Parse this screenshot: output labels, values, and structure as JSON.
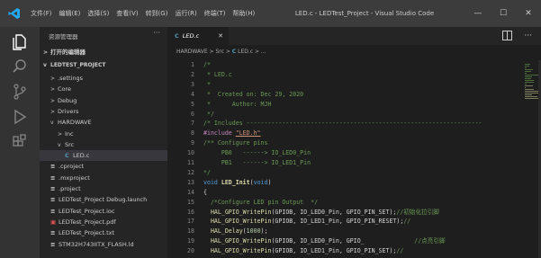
{
  "titlebar": {
    "menu": [
      "文件(F)",
      "编辑(E)",
      "选择(S)",
      "查看(V)",
      "转到(G)",
      "运行(R)",
      "终端(T)",
      "帮助(H)"
    ],
    "title": "LED.c - LEDTest_Project - Visual Studio Code",
    "controls": {
      "minimize": "—",
      "maximize": "☐",
      "close": "✕"
    }
  },
  "activity_bar": {
    "icons": [
      "explorer-icon",
      "search-icon",
      "source-control-icon",
      "run-debug-icon",
      "extensions-icon"
    ]
  },
  "sidebar": {
    "header": "资源管理器",
    "more": "···",
    "open_editors_label": "打开的编辑器",
    "project_label": "LEDTEST_PROJECT",
    "items": [
      {
        "label": ".settings",
        "kind": "folder",
        "expanded": false,
        "depth": 1
      },
      {
        "label": "Core",
        "kind": "folder",
        "expanded": false,
        "depth": 1
      },
      {
        "label": "Debug",
        "kind": "folder",
        "expanded": false,
        "depth": 1
      },
      {
        "label": "Drivers",
        "kind": "folder",
        "expanded": false,
        "depth": 1
      },
      {
        "label": "HARDWAVE",
        "kind": "folder",
        "expanded": true,
        "depth": 1
      },
      {
        "label": "Inc",
        "kind": "folder",
        "expanded": false,
        "depth": 2
      },
      {
        "label": "Src",
        "kind": "folder",
        "expanded": true,
        "depth": 2
      },
      {
        "label": "LED.c",
        "kind": "c",
        "depth": 3,
        "selected": true
      },
      {
        "label": ".cproject",
        "kind": "file",
        "depth": 1
      },
      {
        "label": ".mxproject",
        "kind": "file",
        "depth": 1
      },
      {
        "label": ".project",
        "kind": "file",
        "depth": 1
      },
      {
        "label": "LEDTest_Project Debug.launch",
        "kind": "file",
        "depth": 1
      },
      {
        "label": "LEDTest_Project.ioc",
        "kind": "ioc",
        "depth": 1
      },
      {
        "label": "LEDTest_Project.pdf",
        "kind": "pdf",
        "depth": 1
      },
      {
        "label": "LEDTest_Project.txt",
        "kind": "file",
        "depth": 1
      },
      {
        "label": "STM32H743IITX_FLASH.ld",
        "kind": "file",
        "depth": 1
      }
    ]
  },
  "editor": {
    "tab": {
      "icon_text": "C",
      "label": "LED.c",
      "close": "✕"
    },
    "more": "···",
    "breadcrumb": {
      "parts": [
        "HARDWAVE",
        "Src"
      ],
      "file_icon": "C",
      "file": "LED.c",
      "tail": "..."
    },
    "lines": [
      {
        "n": "1",
        "tokens": [
          {
            "t": "/*",
            "c": "comment"
          }
        ]
      },
      {
        "n": "2",
        "tokens": [
          {
            "t": " * LED.c",
            "c": "comment"
          }
        ]
      },
      {
        "n": "3",
        "tokens": [
          {
            "t": " *",
            "c": "comment"
          }
        ]
      },
      {
        "n": "4",
        "tokens": [
          {
            "t": " *  Created on: Dec 29, 2020",
            "c": "comment"
          }
        ]
      },
      {
        "n": "5",
        "tokens": [
          {
            "t": " *      Author: MJH",
            "c": "comment"
          }
        ]
      },
      {
        "n": "6",
        "tokens": [
          {
            "t": " */",
            "c": "comment"
          }
        ]
      },
      {
        "n": "7",
        "tokens": [
          {
            "t": "/* Includes ------------------------------------------------------------------",
            "c": "comment"
          }
        ]
      },
      {
        "n": "8",
        "tokens": [
          {
            "t": "#include ",
            "c": "macro"
          },
          {
            "t": "\"LED.h\"",
            "c": "string"
          }
        ]
      },
      {
        "n": "9",
        "tokens": [
          {
            "t": "/** Configure pins",
            "c": "comment"
          }
        ]
      },
      {
        "n": "10",
        "tokens": [
          {
            "t": "     PB0   ------> IO_LED0_Pin",
            "c": "comment"
          }
        ]
      },
      {
        "n": "11",
        "tokens": [
          {
            "t": "     PB1   ------> IO_LED1_Pin",
            "c": "comment"
          }
        ]
      },
      {
        "n": "12",
        "tokens": [
          {
            "t": "*/",
            "c": "comment"
          }
        ]
      },
      {
        "n": "13",
        "tokens": [
          {
            "t": "void ",
            "c": "type"
          },
          {
            "t": "LED_Init",
            "c": "decl"
          },
          {
            "t": "(",
            "c": "punc"
          },
          {
            "t": "void",
            "c": "type"
          },
          {
            "t": ")",
            "c": "punc"
          }
        ]
      },
      {
        "n": "14",
        "tokens": [
          {
            "t": "{",
            "c": "punc"
          }
        ]
      },
      {
        "n": "15",
        "tokens": [
          {
            "t": "  /*Configure LED pin Output  */",
            "c": "comment"
          }
        ]
      },
      {
        "n": "16",
        "tokens": [
          {
            "t": "  HAL_GPIO_WritePin",
            "c": "func"
          },
          {
            "t": "(GPIOB, IO_LED0_Pin, GPIO_PIN_SET);",
            "c": "plain"
          },
          {
            "t": "//初始化拉引脚",
            "c": "comment"
          }
        ]
      },
      {
        "n": "17",
        "tokens": [
          {
            "t": "  HAL_GPIO_WritePin",
            "c": "func"
          },
          {
            "t": "(GPIOB, IO_LED1_Pin, GPIO_PIN_RESET);",
            "c": "plain"
          },
          {
            "t": "//",
            "c": "comment"
          }
        ]
      },
      {
        "n": "18",
        "tokens": [
          {
            "t": "  HAL_Delay",
            "c": "func"
          },
          {
            "t": "(",
            "c": "plain"
          },
          {
            "t": "1000",
            "c": "num"
          },
          {
            "t": ");",
            "c": "plain"
          }
        ]
      },
      {
        "n": "19",
        "tokens": [
          {
            "t": "  HAL_GPIO_WritePin",
            "c": "func"
          },
          {
            "t": "(GPIOB, IO_LED0_Pin, GPIO_",
            "c": "plain"
          },
          {
            "t": "              //点亮引脚",
            "c": "comment"
          }
        ]
      },
      {
        "n": "20",
        "tokens": [
          {
            "t": "  HAL_GPIO_WritePin",
            "c": "func"
          },
          {
            "t": "(GPIOB, IO_LED1_Pin, GPIO_PIN_SET);",
            "c": "plain"
          },
          {
            "t": "//",
            "c": "comment"
          }
        ]
      }
    ]
  },
  "colors": {
    "titlebar": "#3c3c3c",
    "activitybar": "#333333",
    "sidebar": "#252526",
    "editor": "#1e1e1e",
    "accent": "#007acc"
  }
}
